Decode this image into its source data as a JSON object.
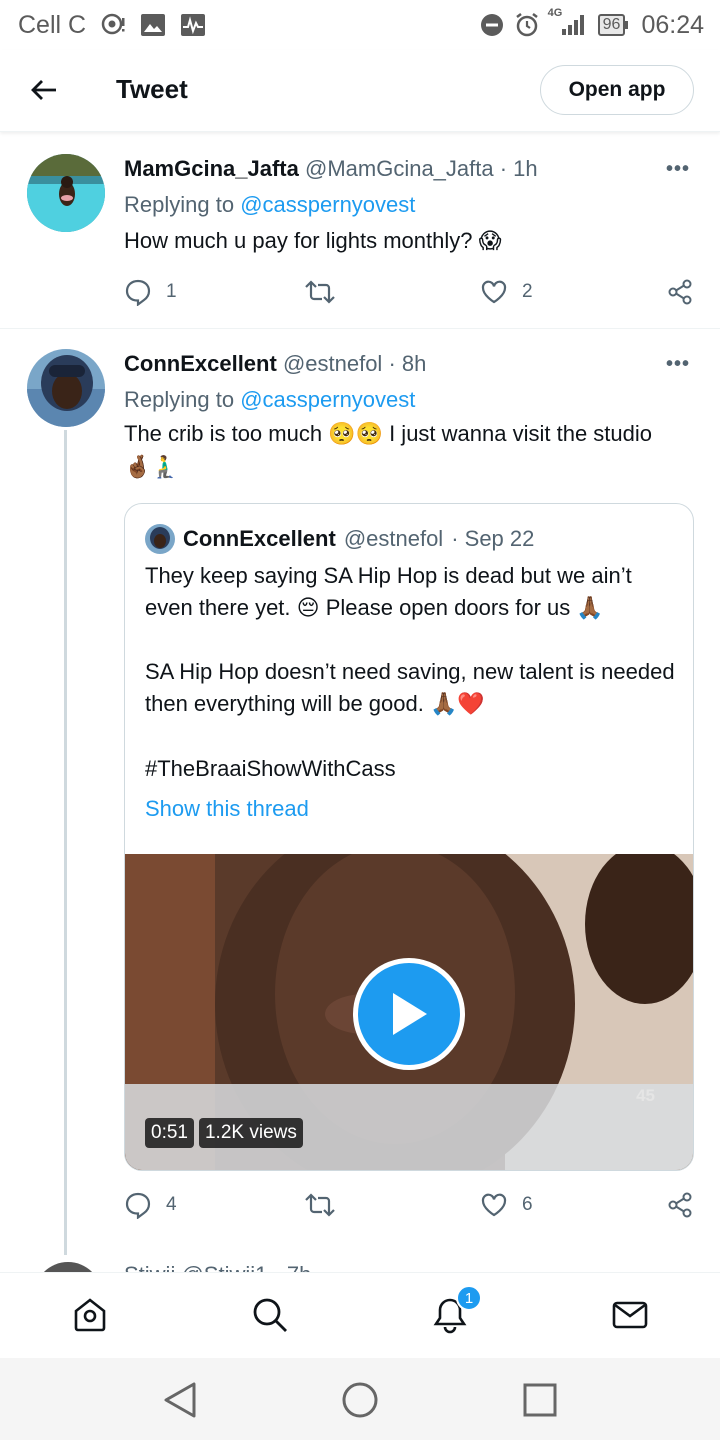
{
  "status_bar": {
    "carrier": "Cell C",
    "network": "4G",
    "battery": "96",
    "time": "06:24"
  },
  "header": {
    "title": "Tweet",
    "open_app_label": "Open app"
  },
  "tweets": [
    {
      "name": "MamGcina_Jafta",
      "handle": "@MamGcina_Jafta",
      "time": "· 1h",
      "replying_prefix": "Replying to",
      "replying_to": "@casspernyovest",
      "text": "How much u pay for lights monthly? 😱",
      "replies": "1",
      "retweets": "",
      "likes": "2"
    },
    {
      "name": "ConnExcellent",
      "handle": "@estnefol",
      "time": "· 8h",
      "replying_prefix": "Replying to",
      "replying_to": "@casspernyovest",
      "text": "The crib is too much 🥺🥺 I just wanna visit the studio 🤞🏾🧎‍♂️",
      "replies": "4",
      "retweets": "",
      "likes": "6"
    }
  ],
  "quoted": {
    "name": "ConnExcellent",
    "handle": "@estnefol",
    "time": "· Sep 22",
    "para1": "They keep saying SA Hip Hop is dead but we ain’t even there yet. 😔 Please open doors for us 🙏🏾",
    "para2": "SA Hip Hop doesn’t need saving, new talent is needed then everything will be good. 🙏🏾❤️",
    "hashtag": "#TheBraaiShowWithCass",
    "show_thread": "Show this thread",
    "video_duration": "0:51",
    "video_views": "1.2K views",
    "video_overlay_count": "45"
  },
  "partial_next": "Stiwii @Stiwii1 · 7h",
  "nav": {
    "notification_count": "1"
  },
  "colors": {
    "accent": "#1d9bf0",
    "text": "#0f1419",
    "muted": "#536471",
    "border": "#cfd9de"
  }
}
